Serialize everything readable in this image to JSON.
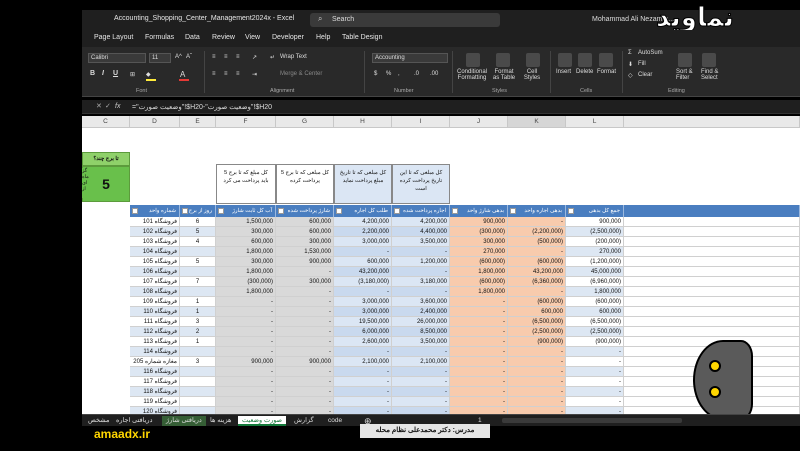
{
  "window": {
    "doc_title": "Accounting_Shopping_Center_Management2024x - Excel",
    "search_label": "Search",
    "user": "Mohammad Ali Nezamm...",
    "logo_text": "نماوید"
  },
  "ribbon_tabs": [
    "Page Layout",
    "Formulas",
    "Data",
    "Review",
    "View",
    "Developer",
    "Help",
    "Table Design"
  ],
  "ribbon": {
    "font_name": "Calibri",
    "font_size": "11",
    "wrap_text": "Wrap Text",
    "merge_center": "Merge & Center",
    "number_format": "Accounting",
    "groups": [
      "Font",
      "Alignment",
      "Number",
      "Styles",
      "Cells",
      "Editing"
    ],
    "buttons": [
      "Conditional Formatting",
      "Format as Table",
      "Cell Styles",
      "Insert",
      "Delete",
      "Format",
      "AutoSum",
      "Fill",
      "Clear",
      "Sort & Filter",
      "Find & Select"
    ]
  },
  "formula_bar": {
    "fx": "fx",
    "formula": "=\"وضعیت صورت\"!$H20-\"وضعیت صورت\"!$H20"
  },
  "columns": [
    "C",
    "D",
    "E",
    "F",
    "G",
    "H",
    "I",
    "J",
    "K",
    "L"
  ],
  "sidebar_box": {
    "label": "تا برج چند؟",
    "value": "5",
    "side": "گز ماه ای از"
  },
  "header_notes": {
    "F": "کل مبلغ که تا برج 5 باید پرداخت می کرد",
    "G": "کل مبلغی که تا برج 5 پرداخت کرده",
    "H": "کل مبلغی که تا تاریخ مبلغ پرداخت نماید",
    "I": "کل مبلغی که تا این تاریخ پرداخت کرده است"
  },
  "table_headers": [
    "شماره واحد",
    "روز از برج",
    "آب کل ثابت شارژ",
    "شارژ پرداخت شده",
    "طلب کل اجاره",
    "اجاره پرداخت شده",
    "بدهی شارژ واحد",
    "بدهی اجاره واحد",
    "جمع کل بدهی"
  ],
  "rows": [
    [
      "فروشگاه 101",
      "6",
      "1,500,000",
      "600,000",
      "4,200,000",
      "4,200,000",
      "900,000",
      "-",
      "900,000"
    ],
    [
      "فروشگاه 102",
      "5",
      "300,000",
      "600,000",
      "2,200,000",
      "4,400,000",
      "(300,000)",
      "(2,200,000)",
      "(2,500,000)"
    ],
    [
      "فروشگاه 103",
      "4",
      "600,000",
      "300,000",
      "3,000,000",
      "3,500,000",
      "300,000",
      "(500,000)",
      "(200,000)"
    ],
    [
      "فروشگاه 104",
      "",
      "1,800,000",
      "1,530,000",
      "-",
      "-",
      "270,000",
      "-",
      "270,000"
    ],
    [
      "فروشگاه 105",
      "5",
      "300,000",
      "900,000",
      "600,000",
      "1,200,000",
      "(600,000)",
      "(600,000)",
      "(1,200,000)"
    ],
    [
      "فروشگاه 106",
      "",
      "1,800,000",
      "-",
      "43,200,000",
      "-",
      "1,800,000",
      "43,200,000",
      "45,000,000"
    ],
    [
      "فروشگاه 107",
      "7",
      "(300,000)",
      "300,000",
      "(3,180,000)",
      "3,180,000",
      "(600,000)",
      "(6,360,000)",
      "(6,960,000)"
    ],
    [
      "فروشگاه 108",
      "",
      "1,800,000",
      "-",
      "-",
      "-",
      "1,800,000",
      "-",
      "1,800,000"
    ],
    [
      "فروشگاه 109",
      "1",
      "-",
      "-",
      "3,000,000",
      "3,600,000",
      "-",
      "(600,000)",
      "(600,000)"
    ],
    [
      "فروشگاه 110",
      "1",
      "-",
      "-",
      "3,000,000",
      "2,400,000",
      "-",
      "600,000",
      "600,000"
    ],
    [
      "فروشگاه 111",
      "3",
      "-",
      "-",
      "19,500,000",
      "26,000,000",
      "-",
      "(6,500,000)",
      "(6,500,000)"
    ],
    [
      "فروشگاه 112",
      "2",
      "-",
      "-",
      "6,000,000",
      "8,500,000",
      "-",
      "(2,500,000)",
      "(2,500,000)"
    ],
    [
      "فروشگاه 113",
      "1",
      "-",
      "-",
      "2,600,000",
      "3,500,000",
      "-",
      "(900,000)",
      "(900,000)"
    ],
    [
      "فروشگاه 114",
      "",
      "-",
      "-",
      "-",
      "-",
      "-",
      "-",
      "-"
    ],
    [
      "مغازه شماره 205",
      "3",
      "900,000",
      "900,000",
      "2,100,000",
      "2,100,000",
      "-",
      "-",
      "-"
    ],
    [
      "فروشگاه 116",
      "",
      "-",
      "-",
      "-",
      "-",
      "-",
      "-",
      "-"
    ],
    [
      "فروشگاه 117",
      "",
      "-",
      "-",
      "-",
      "-",
      "-",
      "-",
      "-"
    ],
    [
      "فروشگاه 118",
      "",
      "-",
      "-",
      "-",
      "-",
      "-",
      "-",
      "-"
    ],
    [
      "فروشگاه 119",
      "",
      "-",
      "-",
      "-",
      "-",
      "-",
      "-",
      "-"
    ],
    [
      "فروشگاه 120",
      "",
      "-",
      "-",
      "-",
      "-",
      "-",
      "-",
      "-"
    ]
  ],
  "sheet_tabs": [
    "مشخص",
    "دریافتی اجاره",
    "دریافتی شارژ",
    "هزینه ها",
    "صورت وضعیت",
    "گزارش",
    "code"
  ],
  "active_sheet": "صورت وضعیت",
  "teacher": "مدرس: دکتر محمدعلی نظام محله",
  "site": "amaadx.ir",
  "page_number": "1"
}
